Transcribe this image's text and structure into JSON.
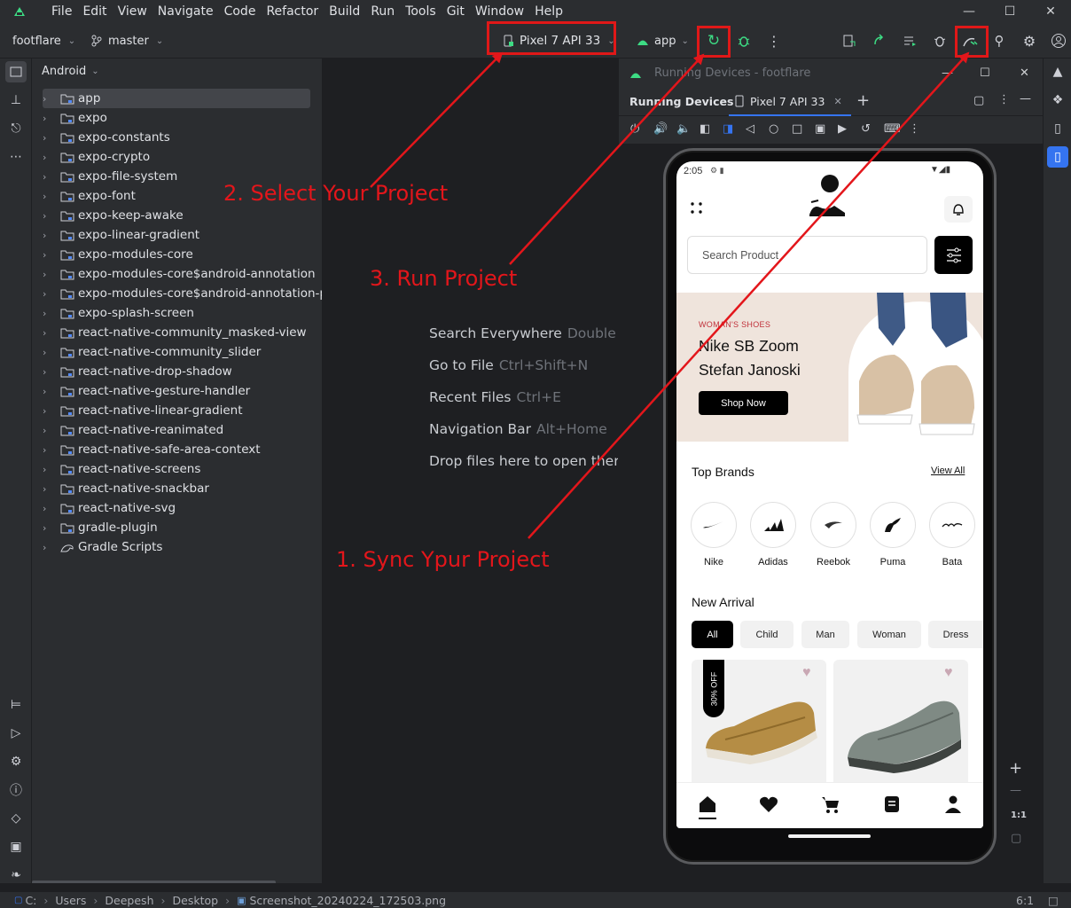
{
  "menubar": {
    "items": [
      "File",
      "Edit",
      "View",
      "Navigate",
      "Code",
      "Refactor",
      "Build",
      "Run",
      "Tools",
      "Git",
      "Window",
      "Help"
    ],
    "window_controls": [
      "minimize",
      "maximize",
      "close"
    ]
  },
  "toolbar": {
    "project": "footflare",
    "branch": "master",
    "device": "Pixel 7 API 33",
    "run_config": "app"
  },
  "project_panel": {
    "view": "Android",
    "items": [
      "app",
      "expo",
      "expo-constants",
      "expo-crypto",
      "expo-file-system",
      "expo-font",
      "expo-keep-awake",
      "expo-linear-gradient",
      "expo-modules-core",
      "expo-modules-core$android-annotation",
      "expo-modules-core$android-annotation-pro",
      "expo-splash-screen",
      "react-native-community_masked-view",
      "react-native-community_slider",
      "react-native-drop-shadow",
      "react-native-gesture-handler",
      "react-native-linear-gradient",
      "react-native-reanimated",
      "react-native-safe-area-context",
      "react-native-screens",
      "react-native-snackbar",
      "react-native-svg",
      "gradle-plugin",
      "Gradle Scripts"
    ]
  },
  "editor_hints": [
    {
      "label": "Search Everywhere",
      "shortcut": "Double"
    },
    {
      "label": "Go to File",
      "shortcut": "Ctrl+Shift+N"
    },
    {
      "label": "Recent Files",
      "shortcut": "Ctrl+E"
    },
    {
      "label": "Navigation Bar",
      "shortcut": "Alt+Home"
    },
    {
      "label": "Drop files here to open ther",
      "shortcut": ""
    }
  ],
  "devices_panel": {
    "title": "Running Devices - footflare",
    "tab_label": "Running Devices",
    "device_tab": "Pixel 7 API 33",
    "zoom_label": "1:1"
  },
  "phone": {
    "time": "2:05",
    "search_placeholder": "Search Product",
    "banner": {
      "kicker": "WOMAN'S SHOES",
      "title_line1": "Nike SB Zoom",
      "title_line2": "Stefan Janoski",
      "cta": "Shop Now"
    },
    "top_brands_title": "Top Brands",
    "view_all": "View All",
    "brands": [
      "Nike",
      "Adidas",
      "Reebok",
      "Puma",
      "Bata"
    ],
    "new_arrival_title": "New Arrival",
    "filters": [
      "All",
      "Child",
      "Man",
      "Woman",
      "Dress"
    ],
    "discount_badge": "30% OFF",
    "nav": [
      "home-icon",
      "heart-icon",
      "cart-icon",
      "orders-icon",
      "profile-icon"
    ]
  },
  "annotations": {
    "step1": "1. Sync Ypur Project",
    "step2": "2. Select Your Project",
    "step3": "3. Run Project",
    "color": "#e3161b"
  },
  "statusbar": {
    "path": [
      "C:",
      "Users",
      "Deepesh",
      "Desktop",
      "Screenshot_20240224_172503.png"
    ],
    "position": "6:1"
  }
}
